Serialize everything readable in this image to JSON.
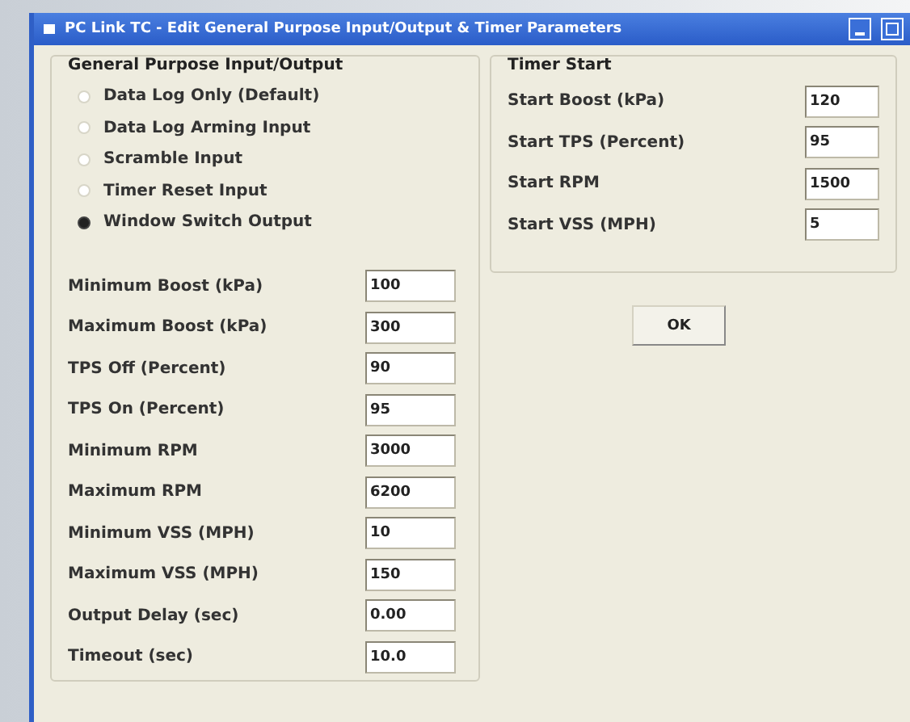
{
  "window": {
    "title": "PC Link TC - Edit General Purpose Input/Output & Timer Parameters"
  },
  "gpio": {
    "title": "General Purpose Input/Output",
    "options": [
      {
        "label": "Data Log Only (Default)",
        "selected": false
      },
      {
        "label": "Data Log Arming Input",
        "selected": false
      },
      {
        "label": "Scramble Input",
        "selected": false
      },
      {
        "label": "Timer Reset Input",
        "selected": false
      },
      {
        "label": "Window Switch Output",
        "selected": true
      }
    ],
    "fields": [
      {
        "label": "Minimum Boost (kPa)",
        "value": "100"
      },
      {
        "label": "Maximum Boost (kPa)",
        "value": "300"
      },
      {
        "label": "TPS Off (Percent)",
        "value": "90"
      },
      {
        "label": "TPS On (Percent)",
        "value": "95"
      },
      {
        "label": "Minimum RPM",
        "value": "3000"
      },
      {
        "label": "Maximum RPM",
        "value": "6200"
      },
      {
        "label": "Minimum VSS (MPH)",
        "value": "10"
      },
      {
        "label": "Maximum VSS (MPH)",
        "value": "150"
      },
      {
        "label": "Output Delay (sec)",
        "value": "0.00"
      },
      {
        "label": "Timeout (sec)",
        "value": "10.0"
      }
    ]
  },
  "timer_start": {
    "title": "Timer Start",
    "fields": [
      {
        "label": "Start Boost (kPa)",
        "value": "120"
      },
      {
        "label": "Start TPS (Percent)",
        "value": "95"
      },
      {
        "label": "Start RPM",
        "value": "1500"
      },
      {
        "label": "Start VSS (MPH)",
        "value": "5"
      }
    ]
  },
  "buttons": [
    "OK"
  ]
}
